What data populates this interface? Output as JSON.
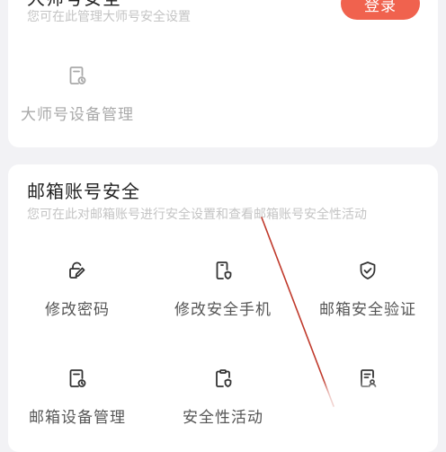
{
  "top_section": {
    "title": "大师号安全",
    "subtitle": "您可在此管理大师号安全设置",
    "login_label": "登录",
    "items": [
      {
        "label": "大师号设备管理",
        "icon": "device-manage-icon"
      }
    ]
  },
  "mail_section": {
    "title": "邮箱账号安全",
    "subtitle": "您可在此对邮箱账号进行安全设置和查看邮箱账号安全性活动",
    "items": [
      {
        "label": "修改密码",
        "icon": "edit-password-icon"
      },
      {
        "label": "修改安全手机",
        "icon": "security-phone-icon"
      },
      {
        "label": "邮箱安全验证",
        "icon": "shield-check-icon"
      },
      {
        "label": "邮箱设备管理",
        "icon": "device-manage-icon"
      },
      {
        "label": "安全性活动",
        "icon": "security-activity-icon"
      },
      {
        "label": "",
        "icon": "user-card-icon"
      }
    ]
  },
  "colors": {
    "accent": "#f0624e",
    "icon": "#333333",
    "faded": "#a9a9a9"
  }
}
